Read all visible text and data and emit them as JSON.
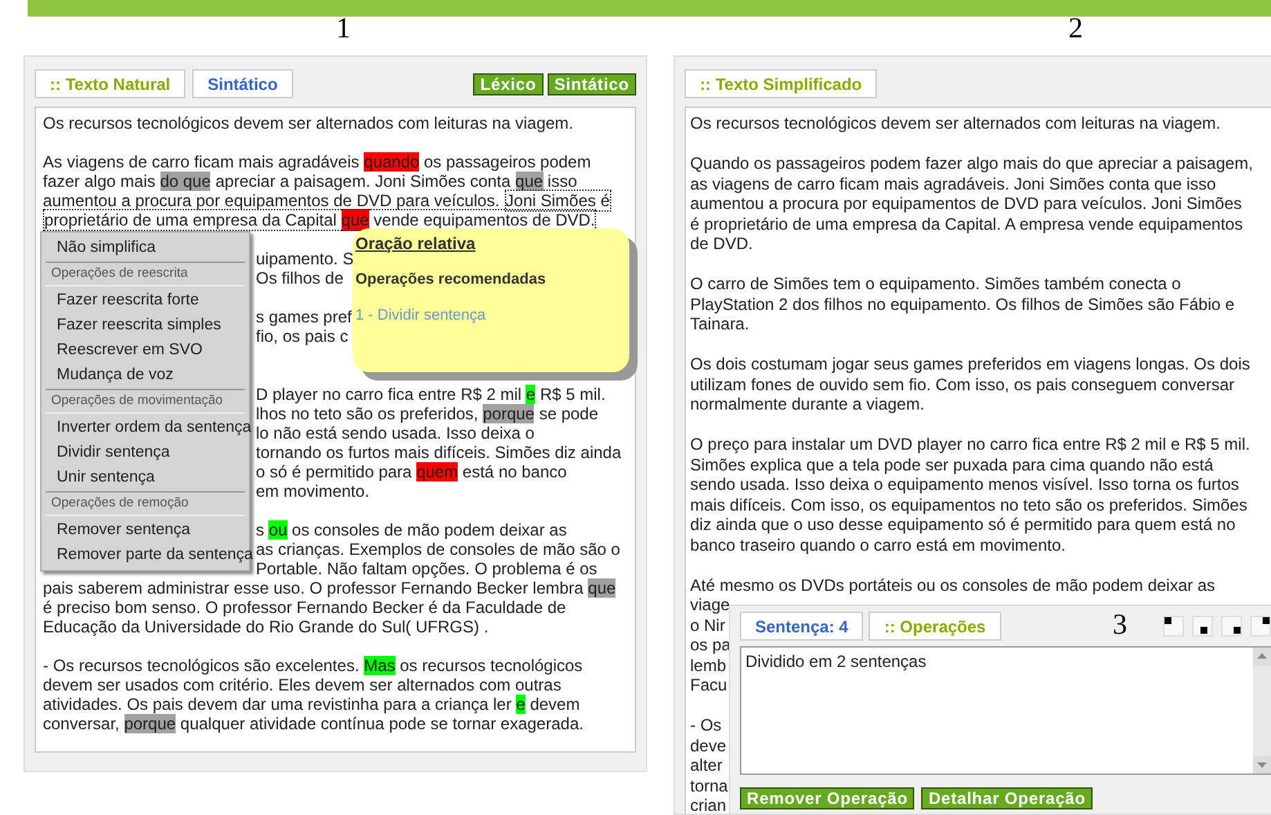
{
  "left": {
    "number": "1",
    "tabs": [
      {
        "label": ":: Texto Natural",
        "selected": true
      },
      {
        "label": "Sintático",
        "selected": false
      }
    ],
    "buttons": [
      "Léxico",
      "Sintático"
    ],
    "paragraphs": [
      {
        "lines": [
          {
            "kind": "full",
            "segments": [
              {
                "text": "Os recursos tecnológicos devem ser alternados com leituras na viagem.",
                "kind": "plain"
              }
            ]
          }
        ]
      },
      {
        "lines": [
          {
            "kind": "full",
            "segments": [
              {
                "text": "As viagens de carro ficam mais agradáveis ",
                "kind": "plain"
              },
              {
                "text": "quando",
                "color": "#ff0000",
                "kind": "plain"
              },
              {
                "text": " os passageiros podem",
                "kind": "plain"
              }
            ]
          },
          {
            "kind": "full",
            "segments": [
              {
                "text": "fazer algo mais ",
                "kind": "plain"
              },
              {
                "text": "do que",
                "color": "#a0a0a0",
                "kind": "plain"
              },
              {
                "text": " apreciar a paisagem. Joni Simões conta ",
                "kind": "plain"
              },
              {
                "text": "que",
                "color": "#a0a0a0",
                "kind": "plain"
              },
              {
                "text": " isso",
                "kind": "plain"
              }
            ]
          },
          {
            "kind": "full",
            "segments": [
              {
                "text": "aumentou a procura por equipamentos de DVD para veículos. ",
                "kind": "plain"
              },
              {
                "text": "Joni Simões é",
                "kind": "selected"
              }
            ]
          },
          {
            "kind": "full",
            "segments": [
              {
                "text": "proprietário de uma empresa da Capital ",
                "kind": "selected"
              },
              {
                "text": "que",
                "color": "#ff0000",
                "kind": "selected"
              },
              {
                "text": " vende equipamentos de DVD.",
                "kind": "selected"
              }
            ]
          }
        ]
      },
      {
        "lines": [
          {
            "kind": "after_menu",
            "segments": [
              {
                "text": "uipamento. S",
                "kind": "plain"
              }
            ]
          },
          {
            "kind": "after_menu",
            "segments": [
              {
                "text": "Os filhos de",
                "kind": "plain"
              }
            ]
          }
        ]
      },
      {
        "lines": [
          {
            "kind": "after_menu",
            "segments": [
              {
                "text": "s games pref",
                "kind": "plain"
              }
            ]
          },
          {
            "kind": "after_menu",
            "segments": [
              {
                "text": "fio, os pais c",
                "kind": "plain"
              }
            ]
          },
          {
            "kind": "covered"
          }
        ]
      },
      {
        "lines": [
          {
            "kind": "after_menu",
            "segments": [
              {
                "text": "D player no carro fica entre R$ 2 mil ",
                "kind": "plain"
              },
              {
                "text": "e",
                "color": "#00ff00",
                "kind": "plain"
              },
              {
                "text": " R$ 5 mil.",
                "kind": "plain"
              }
            ]
          },
          {
            "kind": "after_menu",
            "segments": [
              {
                "text": "lhos no teto são os preferidos, ",
                "kind": "plain"
              },
              {
                "text": "porque",
                "color": "#a0a0a0",
                "kind": "plain"
              },
              {
                "text": " se pode",
                "kind": "plain"
              }
            ]
          },
          {
            "kind": "after_menu",
            "segments": [
              {
                "text": "lo não está sendo usada. Isso deixa o",
                "kind": "plain"
              }
            ]
          },
          {
            "kind": "after_menu",
            "segments": [
              {
                "text": "tornando os furtos mais difíceis. Simões diz ainda",
                "kind": "plain"
              }
            ]
          },
          {
            "kind": "after_menu",
            "segments": [
              {
                "text": "o só é permitido para ",
                "kind": "plain"
              },
              {
                "text": "quem",
                "color": "#ff0000",
                "kind": "plain"
              },
              {
                "text": " está no banco",
                "kind": "plain"
              }
            ]
          },
          {
            "kind": "after_menu",
            "segments": [
              {
                "text": "em movimento.",
                "kind": "plain"
              }
            ]
          }
        ]
      },
      {
        "lines": [
          {
            "kind": "after_menu",
            "segments": [
              {
                "text": "s ",
                "kind": "plain"
              },
              {
                "text": "ou",
                "color": "#00ff00",
                "kind": "plain"
              },
              {
                "text": " os consoles de mão podem deixar as",
                "kind": "plain"
              }
            ]
          },
          {
            "kind": "after_menu",
            "segments": [
              {
                "text": "as crianças. Exemplos de consoles de mão são o",
                "kind": "plain"
              }
            ]
          },
          {
            "kind": "after_menu",
            "segments": [
              {
                "text": "Portable. Não faltam opções. O problema é os",
                "kind": "plain"
              }
            ]
          },
          {
            "kind": "full",
            "segments": [
              {
                "text": "pais saberem administrar esse uso. O professor Fernando Becker lembra ",
                "kind": "plain"
              },
              {
                "text": "que",
                "color": "#a0a0a0",
                "kind": "plain"
              }
            ]
          },
          {
            "kind": "full",
            "segments": [
              {
                "text": "é preciso bom senso. O professor Fernando Becker é da Faculdade de",
                "kind": "plain"
              }
            ]
          },
          {
            "kind": "full",
            "segments": [
              {
                "text": "Educação da Universidade do Rio Grande do Sul( UFRGS) .",
                "kind": "plain"
              }
            ]
          }
        ]
      },
      {
        "lines": [
          {
            "kind": "full",
            "segments": [
              {
                "text": "- Os recursos tecnológicos são excelentes. ",
                "kind": "plain"
              },
              {
                "text": "Mas",
                "color": "#00ff00",
                "kind": "plain"
              },
              {
                "text": " os recursos tecnológicos",
                "kind": "plain"
              }
            ]
          },
          {
            "kind": "full",
            "segments": [
              {
                "text": "devem ser usados com critério. Eles devem ser alternados com outras",
                "kind": "plain"
              }
            ]
          },
          {
            "kind": "full",
            "segments": [
              {
                "text": "atividades. Os pais devem dar uma revistinha para a criança ler ",
                "kind": "plain"
              },
              {
                "text": "e",
                "color": "#00ff00",
                "kind": "plain"
              },
              {
                "text": " devem",
                "kind": "plain"
              }
            ]
          },
          {
            "kind": "full",
            "segments": [
              {
                "text": "conversar, ",
                "kind": "plain"
              },
              {
                "text": "porque",
                "color": "#a0a0a0",
                "kind": "plain"
              },
              {
                "text": " qualquer atividade contínua pode se tornar exagerada.",
                "kind": "plain"
              }
            ]
          }
        ]
      }
    ],
    "menu": [
      {
        "kind": "item",
        "label": "Não simplifica"
      },
      {
        "kind": "header",
        "label": "Operações de reescrita"
      },
      {
        "kind": "item",
        "label": "Fazer reescrita forte"
      },
      {
        "kind": "item",
        "label": "Fazer reescrita simples"
      },
      {
        "kind": "item",
        "label": "Reescrever em SVO"
      },
      {
        "kind": "item",
        "label": "Mudança de voz"
      },
      {
        "kind": "header",
        "label": "Operações de movimentação"
      },
      {
        "kind": "item",
        "label": "Inverter ordem da sentença"
      },
      {
        "kind": "item",
        "label": "Dividir sentença"
      },
      {
        "kind": "item",
        "label": "Unir sentença"
      },
      {
        "kind": "header",
        "label": "Operações de remoção"
      },
      {
        "kind": "item",
        "label": "Remover sentença"
      },
      {
        "kind": "item",
        "label": "Remover parte da sentença"
      }
    ],
    "tooltip": {
      "title": "Oração relativa",
      "subtitle": "Operações recomendadas",
      "links": [
        "1 - Dividir sentença"
      ]
    }
  },
  "right": {
    "number": "2",
    "tabs": [
      {
        "label": ":: Texto Simplificado",
        "selected": true
      }
    ],
    "paragraphs": [
      [
        "Os recursos tecnológicos devem ser alternados com leituras na viagem."
      ],
      [
        "Quando os passageiros podem fazer algo mais do que apreciar a paisagem,",
        "as viagens de carro ficam mais agradáveis. Joni Simões conta que isso",
        "aumentou a procura por equipamentos de DVD para veículos. Joni Simões",
        "é proprietário de uma empresa da Capital. A empresa vende equipamentos",
        "de DVD."
      ],
      [
        "O carro de Simões tem o equipamento. Simões também conecta o",
        "PlayStation 2 dos filhos no equipamento. Os filhos de Simões são Fábio e",
        "Tainara."
      ],
      [
        "Os dois costumam jogar seus games preferidos em viagens longas. Os dois",
        "utilizam fones de ouvido sem fio. Com isso, os pais conseguem conversar",
        "normalmente durante a viagem."
      ],
      [
        "O preço para instalar um DVD player no carro fica entre R$ 2 mil e R$ 5 mil.",
        "Simões explica que a tela pode ser puxada para cima quando não está",
        "sendo usada. Isso deixa o equipamento menos visível. Isso torna os furtos",
        "mais difíceis. Com isso, os equipamentos no teto são os preferidos. Simões",
        "diz ainda que o uso desse equipamento só é permitido para quem está no",
        "banco traseiro quando o carro está em movimento."
      ],
      [
        "Até mesmo os DVDs portáteis ou os consoles de mão podem deixar as",
        "viage",
        "o Nir",
        "os pa",
        "lemb",
        "Facu"
      ],
      [
        "- Os",
        "deve",
        "alter",
        "torna",
        "crian"
      ]
    ]
  },
  "operations": {
    "number": "3",
    "tabs": [
      {
        "label": "Sentença: 4",
        "selected": false
      },
      {
        "label": ":: Operações",
        "selected": true
      }
    ],
    "text": "Dividido em 2 sentenças",
    "buttons": [
      "Remover Operação",
      "Detalhar Operação"
    ]
  }
}
